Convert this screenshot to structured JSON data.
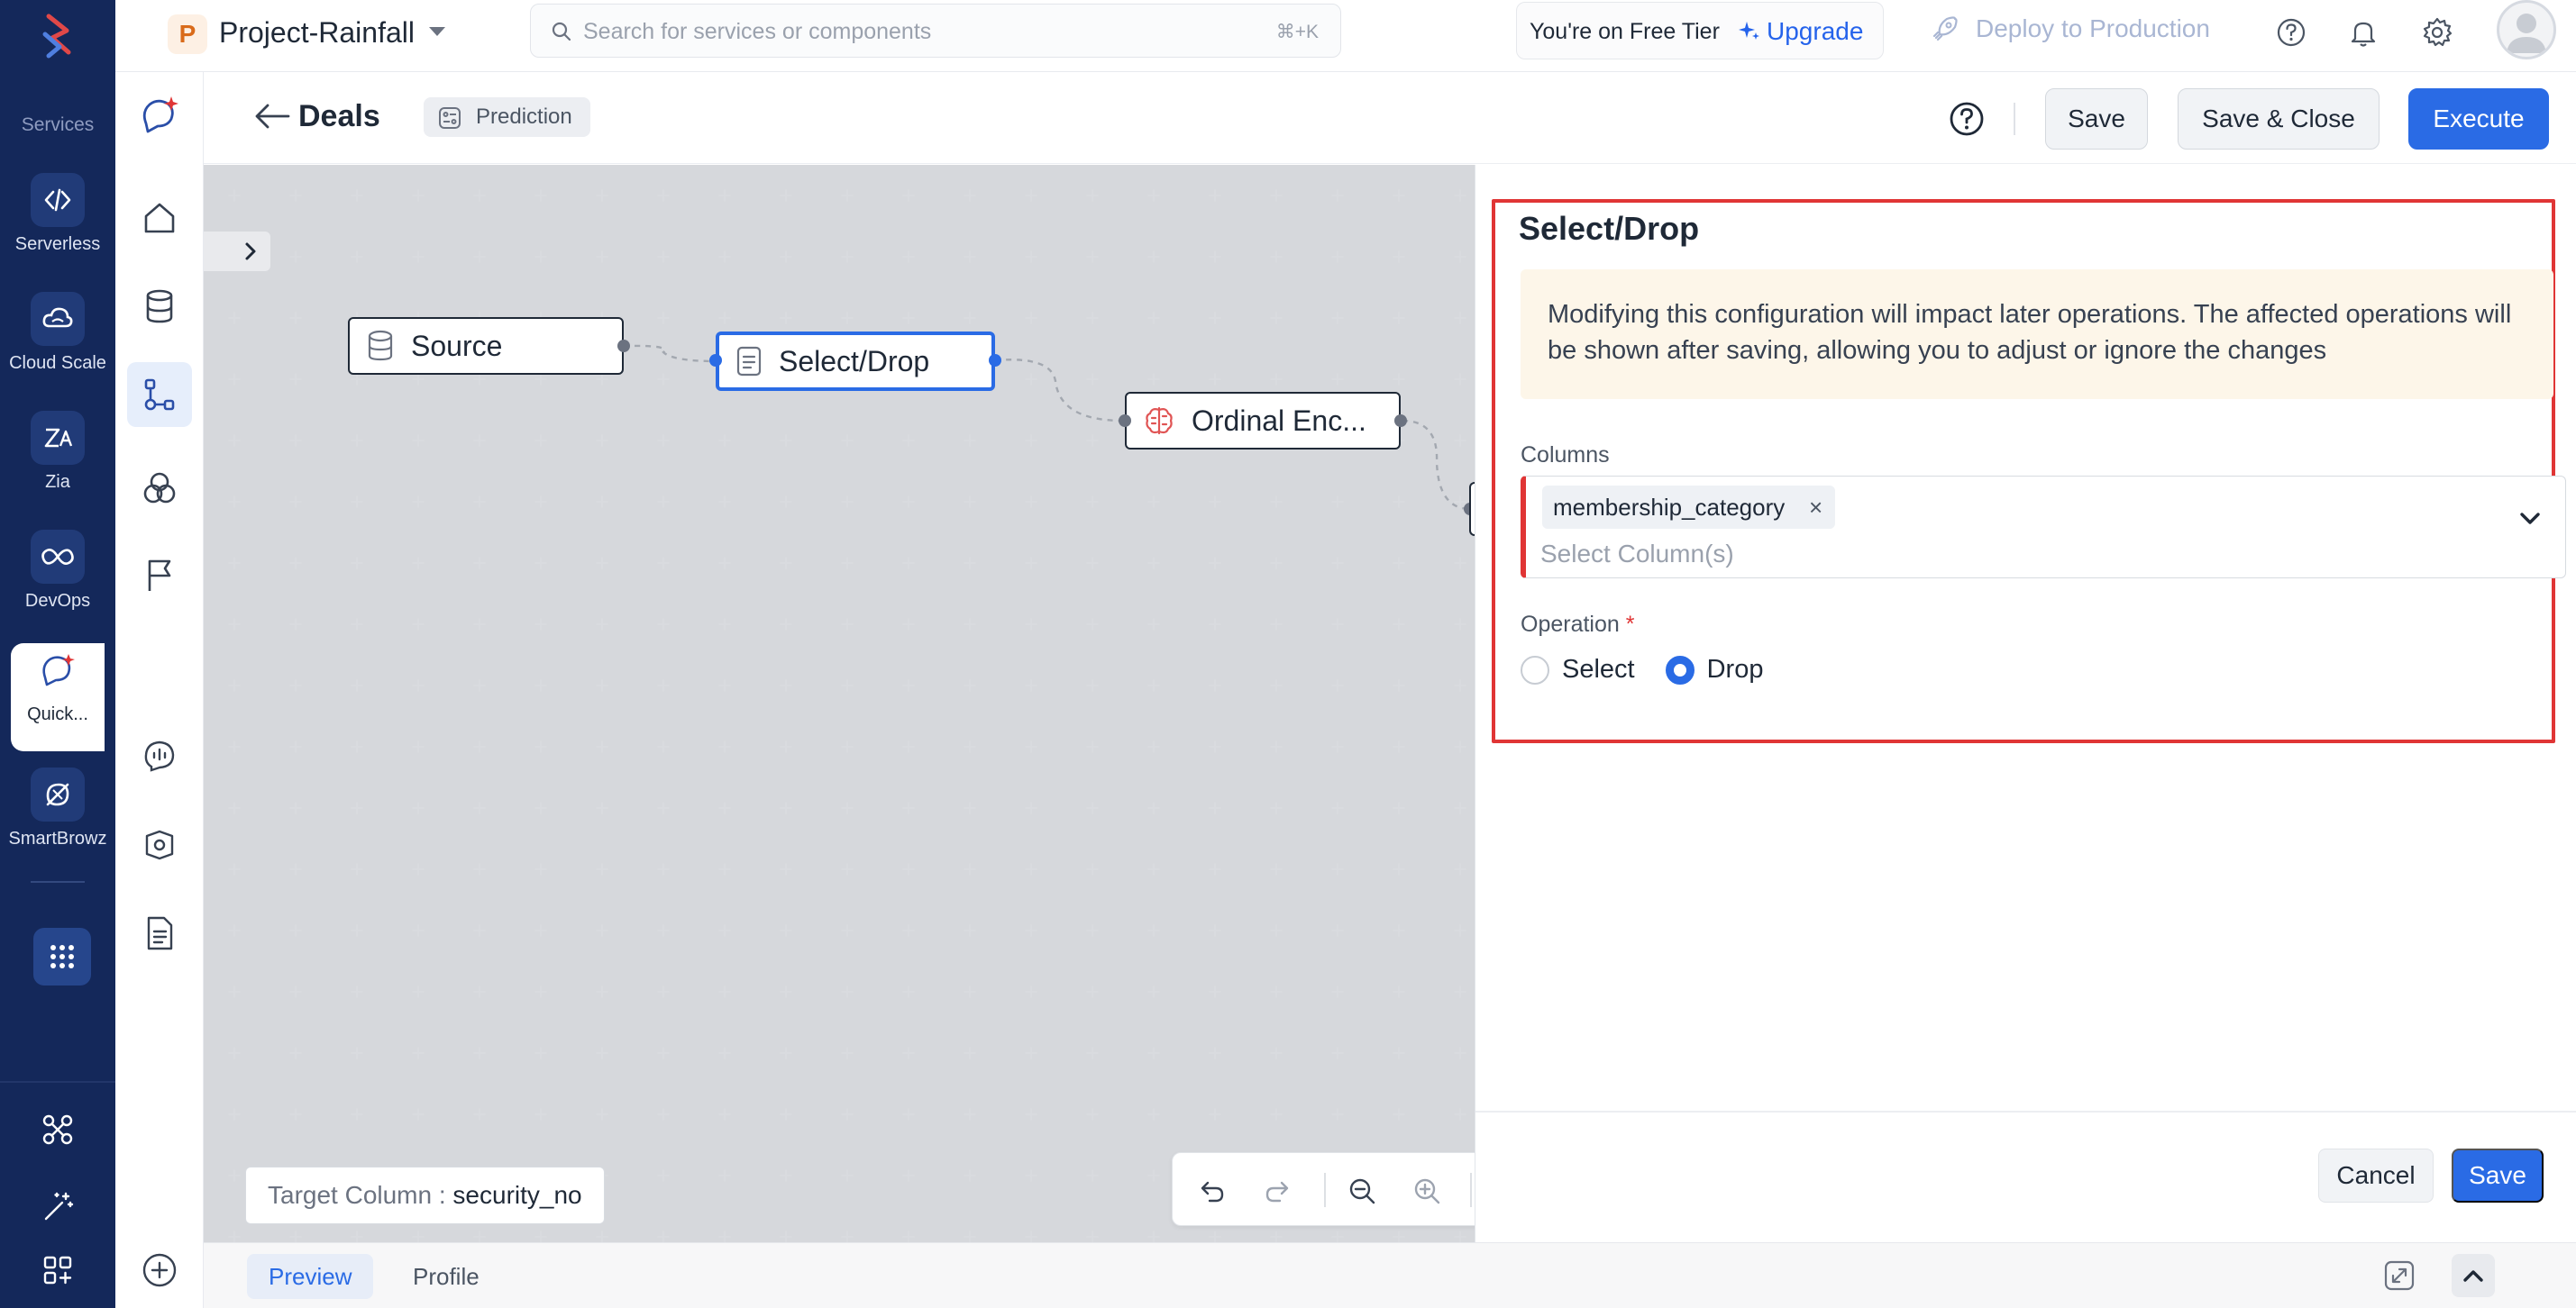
{
  "rail": {
    "services_label": "Services",
    "items": [
      {
        "label": "Serverless",
        "icon": "code-brackets-icon"
      },
      {
        "label": "Cloud Scale",
        "icon": "cloud-icon"
      },
      {
        "label": "Zia",
        "icon": "zia-icon"
      },
      {
        "label": "DevOps",
        "icon": "infinity-icon"
      },
      {
        "label": "Quick...",
        "icon": "quickml-icon"
      },
      {
        "label": "SmartBrowz",
        "icon": "browser-icon"
      }
    ]
  },
  "header": {
    "project_initial": "P",
    "project_name": "Project-Rainfall",
    "search_placeholder": "Search for services or components",
    "search_shortcut": "⌘+K",
    "tier_text": "You're on Free Tier",
    "upgrade_label": "Upgrade",
    "deploy_label": "Deploy to Production"
  },
  "page": {
    "title": "Deals",
    "tag": "Prediction",
    "save_label": "Save",
    "save_close_label": "Save & Close",
    "execute_label": "Execute"
  },
  "canvas": {
    "nodes": [
      {
        "label": "Source",
        "icon": "database-icon"
      },
      {
        "label": "Select/Drop",
        "icon": "document-icon"
      },
      {
        "label": "Ordinal Enc...",
        "icon": "brain-icon"
      }
    ],
    "target_column_label": "Target Column :",
    "target_column_value": "security_no"
  },
  "bottom": {
    "tabs": [
      "Preview",
      "Profile"
    ]
  },
  "panel": {
    "title": "Select/Drop",
    "warning": "Modifying this configuration will impact later operations. The affected operations will be shown after saving, allowing you to adjust or ignore the changes",
    "columns_label": "Columns",
    "selected_column": "membership_category",
    "chip_remove": "×",
    "columns_placeholder": "Select Column(s)",
    "operation_label": "Operation",
    "required_mark": "*",
    "options": [
      "Select",
      "Drop"
    ],
    "selected_option": "Drop",
    "cancel_label": "Cancel",
    "save_label": "Save"
  },
  "colors": {
    "rail_bg": "#14285a",
    "primary": "#2a6be5",
    "highlight": "#e03535"
  }
}
